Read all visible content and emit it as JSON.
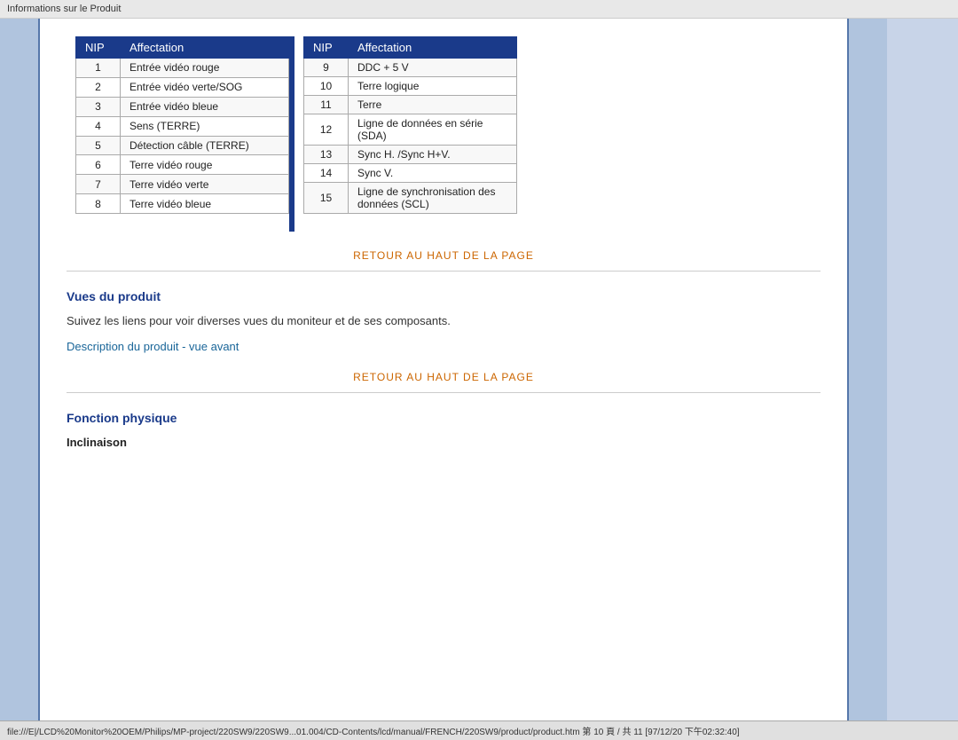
{
  "topbar": {
    "label": "Informations sur le Produit"
  },
  "table": {
    "col1_header_nip": "NIP",
    "col1_header_affectation": "Affectation",
    "col2_header_nip": "NIP",
    "col2_header_affectation": "Affectation",
    "left_rows": [
      {
        "nip": "1",
        "affectation": "Entrée vidéo rouge"
      },
      {
        "nip": "2",
        "affectation": "Entrée vidéo verte/SOG"
      },
      {
        "nip": "3",
        "affectation": "Entrée vidéo bleue"
      },
      {
        "nip": "4",
        "affectation": "Sens (TERRE)"
      },
      {
        "nip": "5",
        "affectation": "Détection câble (TERRE)"
      },
      {
        "nip": "6",
        "affectation": "Terre vidéo rouge"
      },
      {
        "nip": "7",
        "affectation": "Terre vidéo verte"
      },
      {
        "nip": "8",
        "affectation": "Terre vidéo bleue"
      }
    ],
    "right_rows": [
      {
        "nip": "9",
        "affectation": "DDC + 5 V"
      },
      {
        "nip": "10",
        "affectation": "Terre logique"
      },
      {
        "nip": "11",
        "affectation": "Terre"
      },
      {
        "nip": "12",
        "affectation": "Ligne de données en série (SDA)"
      },
      {
        "nip": "13",
        "affectation": "Sync H. /Sync H+V."
      },
      {
        "nip": "14",
        "affectation": "Sync V."
      },
      {
        "nip": "15",
        "affectation": "Ligne de synchronisation des données (SCL)"
      }
    ]
  },
  "retour1": {
    "label": "RETOUR AU HAUT DE LA PAGE"
  },
  "vues": {
    "title": "Vues du produit",
    "text": "Suivez les liens pour voir diverses vues du moniteur et de ses composants.",
    "link": "Description du produit - vue avant"
  },
  "retour2": {
    "label": "RETOUR AU HAUT DE LA PAGE"
  },
  "fonction": {
    "title": "Fonction physique",
    "inclinaison": "Inclinaison"
  },
  "bottombar": {
    "label": "file:///E|/LCD%20Monitor%20OEM/Philips/MP-project/220SW9/220SW9...01.004/CD-Contents/lcd/manual/FRENCH/220SW9/product/product.htm 第 10 頁 / 共 11 [97/12/20 下午02:32:40]"
  }
}
